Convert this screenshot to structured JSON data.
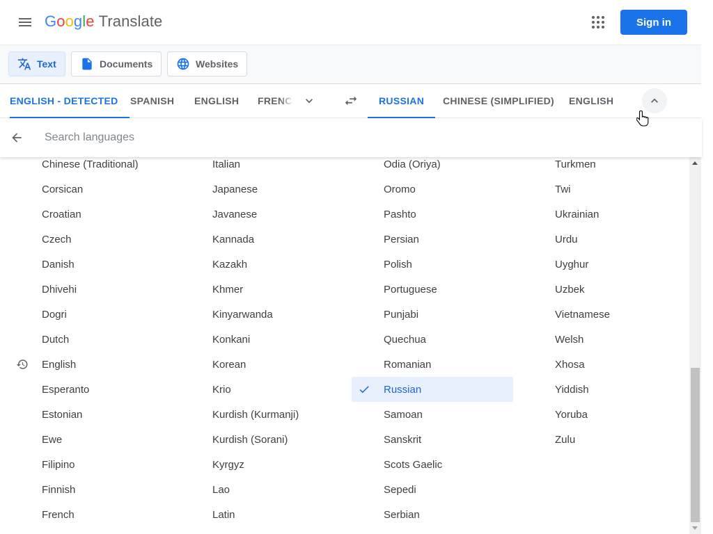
{
  "header": {
    "logo_letters": [
      "G",
      "o",
      "o",
      "g",
      "l",
      "e"
    ],
    "logo_colors": [
      "#4285f4",
      "#ea4335",
      "#fbbc04",
      "#4285f4",
      "#34a853",
      "#ea4335"
    ],
    "product": "Translate",
    "signin_label": "Sign in",
    "menu_icon": "hamburger-menu-icon",
    "apps_icon": "apps-grid-icon"
  },
  "modes": [
    {
      "label": "Text",
      "icon": "translate-icon",
      "active": true
    },
    {
      "label": "Documents",
      "icon": "document-icon",
      "active": false
    },
    {
      "label": "Websites",
      "icon": "globe-icon",
      "active": false
    }
  ],
  "source_langs": [
    {
      "label": "ENGLISH - DETECTED",
      "active": true
    },
    {
      "label": "SPANISH",
      "active": false
    },
    {
      "label": "ENGLISH",
      "active": false
    },
    {
      "label": "FRENCH",
      "active": false
    }
  ],
  "target_langs": [
    {
      "label": "RUSSIAN",
      "active": true
    },
    {
      "label": "CHINESE (SIMPLIFIED)",
      "active": false
    },
    {
      "label": "ENGLISH",
      "active": false
    }
  ],
  "search": {
    "placeholder": "Search languages"
  },
  "languages": {
    "columns": [
      [
        "Chinese (Traditional)",
        "Corsican",
        "Croatian",
        "Czech",
        "Danish",
        "Dhivehi",
        "Dogri",
        "Dutch",
        "English",
        "Esperanto",
        "Estonian",
        "Ewe",
        "Filipino",
        "Finnish",
        "French"
      ],
      [
        "Italian",
        "Japanese",
        "Javanese",
        "Kannada",
        "Kazakh",
        "Khmer",
        "Kinyarwanda",
        "Konkani",
        "Korean",
        "Krio",
        "Kurdish (Kurmanji)",
        "Kurdish (Sorani)",
        "Kyrgyz",
        "Lao",
        "Latin"
      ],
      [
        "Odia (Oriya)",
        "Oromo",
        "Pashto",
        "Persian",
        "Polish",
        "Portuguese",
        "Punjabi",
        "Quechua",
        "Romanian",
        "Russian",
        "Samoan",
        "Sanskrit",
        "Scots Gaelic",
        "Sepedi",
        "Serbian"
      ],
      [
        "Turkmen",
        "Twi",
        "Ukrainian",
        "Urdu",
        "Uyghur",
        "Uzbek",
        "Vietnamese",
        "Welsh",
        "Xhosa",
        "Yiddish",
        "Yoruba",
        "Zulu"
      ]
    ],
    "selected": "Russian",
    "recent": [
      "English"
    ]
  },
  "colors": {
    "accent": "#1a73e8",
    "selected_bg": "#e8f0fe"
  }
}
